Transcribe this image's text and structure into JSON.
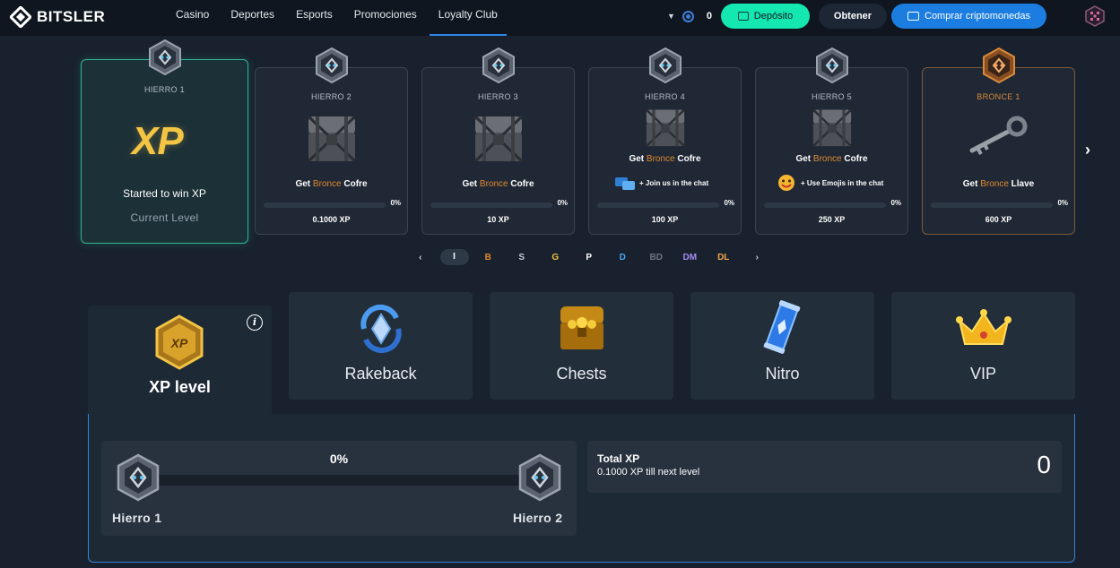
{
  "header": {
    "brand": "BITSLER",
    "nav": [
      {
        "label": "Casino",
        "active": false
      },
      {
        "label": "Deportes",
        "active": false
      },
      {
        "label": "Esports",
        "active": false
      },
      {
        "label": "Promociones",
        "active": false
      },
      {
        "label": "Loyalty Club",
        "active": true
      }
    ],
    "balance": "0",
    "deposit_label": "Depósito",
    "obtener_label": "Obtener",
    "buy_crypto_label": "Comprar criptomonedas"
  },
  "levels": [
    {
      "name": "HIERRO 1",
      "xp_logo": "XP",
      "started": "Started to win XP",
      "status": "Current Level"
    },
    {
      "name": "HIERRO 2",
      "reward_prefix": "Get",
      "reward_tier": "Bronce",
      "reward_item": "Cofre",
      "progress": "0%",
      "xp_required": "0.1000 XP"
    },
    {
      "name": "HIERRO 3",
      "reward_prefix": "Get",
      "reward_tier": "Bronce",
      "reward_item": "Cofre",
      "progress": "0%",
      "xp_required": "10 XP"
    },
    {
      "name": "HIERRO 4",
      "reward_prefix": "Get",
      "reward_tier": "Bronce",
      "reward_item": "Cofre",
      "task": "+ Join us in the chat",
      "progress": "0%",
      "xp_required": "100 XP"
    },
    {
      "name": "HIERRO 5",
      "reward_prefix": "Get",
      "reward_tier": "Bronce",
      "reward_item": "Cofre",
      "task": "+ Use Emojis in the chat",
      "progress": "0%",
      "xp_required": "250 XP"
    },
    {
      "name": "BRONCE 1",
      "reward_prefix": "Get",
      "reward_tier": "Bronce",
      "reward_item": "Llave",
      "progress": "0%",
      "xp_required": "600 XP"
    }
  ],
  "tiers": {
    "prev": "‹",
    "next": "›",
    "items": [
      {
        "label": "I",
        "color": "#ffffff",
        "active": true
      },
      {
        "label": "B",
        "color": "#e08a32"
      },
      {
        "label": "S",
        "color": "#c7cdd4"
      },
      {
        "label": "G",
        "color": "#f3c23b"
      },
      {
        "label": "P",
        "color": "#ffffff"
      },
      {
        "label": "D",
        "color": "#4aa6f0"
      },
      {
        "label": "BD",
        "color": "#6f7884"
      },
      {
        "label": "DM",
        "color": "#a98bf5"
      },
      {
        "label": "DL",
        "color": "#f3a84b"
      }
    ]
  },
  "tabs": [
    {
      "label": "XP level",
      "icon": "xp-badge-icon",
      "active": true
    },
    {
      "label": "Rakeback",
      "icon": "rakeback-icon"
    },
    {
      "label": "Chests",
      "icon": "chest-icon"
    },
    {
      "label": "Nitro",
      "icon": "nitro-icon"
    },
    {
      "label": "VIP",
      "icon": "crown-icon"
    }
  ],
  "xp_panel": {
    "progress_label": "0%",
    "progress": 0,
    "from_level": "Hierro 1",
    "to_level": "Hierro 2",
    "total_title": "Total XP",
    "till_next": "0.1000 XP till next level",
    "total_value": "0"
  },
  "colors": {
    "accent": "#14e8b0",
    "primary": "#1c7de0",
    "bronze": "#e08a32",
    "gold": "#f4c544"
  }
}
